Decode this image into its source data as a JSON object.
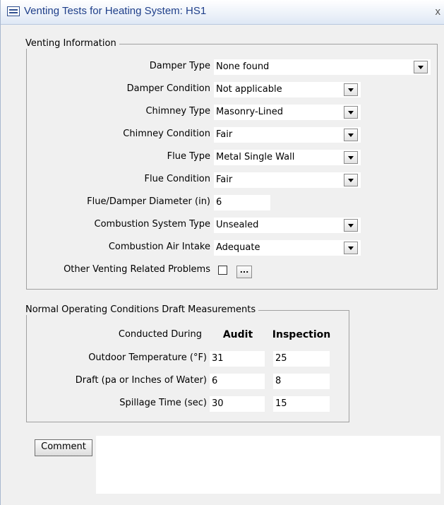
{
  "window": {
    "title": "Venting Tests for Heating System: HS1",
    "close_glyph": "x"
  },
  "venting": {
    "legend": "Venting Information",
    "rows": [
      {
        "label": "Damper Type",
        "value": "None found"
      },
      {
        "label": "Damper Condition",
        "value": "Not applicable"
      },
      {
        "label": "Chimney Type",
        "value": "Masonry-Lined"
      },
      {
        "label": "Chimney Condition",
        "value": "Fair"
      },
      {
        "label": "Flue Type",
        "value": "Metal Single Wall"
      },
      {
        "label": "Flue Condition",
        "value": "Fair"
      },
      {
        "label": "Flue/Damper Diameter (in)",
        "value": "6"
      },
      {
        "label": "Combustion System Type",
        "value": "Unsealed"
      },
      {
        "label": "Combustion Air Intake",
        "value": "Adequate"
      },
      {
        "label": "Other Venting Related Problems",
        "checked": false,
        "button": "..."
      }
    ]
  },
  "draft": {
    "legend": "Normal Operating Conditions Draft Measurements",
    "conducted_label": "Conducted During",
    "col_audit": "Audit",
    "col_inspection": "Inspection",
    "rows": [
      {
        "label": "Outdoor Temperature (°F)",
        "audit": "31",
        "inspection": "25"
      },
      {
        "label": "Draft (pa or Inches of Water)",
        "audit": "6",
        "inspection": "8"
      },
      {
        "label": "Spillage Time (sec)",
        "audit": "30",
        "inspection": "15"
      }
    ]
  },
  "comment": {
    "button_label": "Comment",
    "value": ""
  }
}
